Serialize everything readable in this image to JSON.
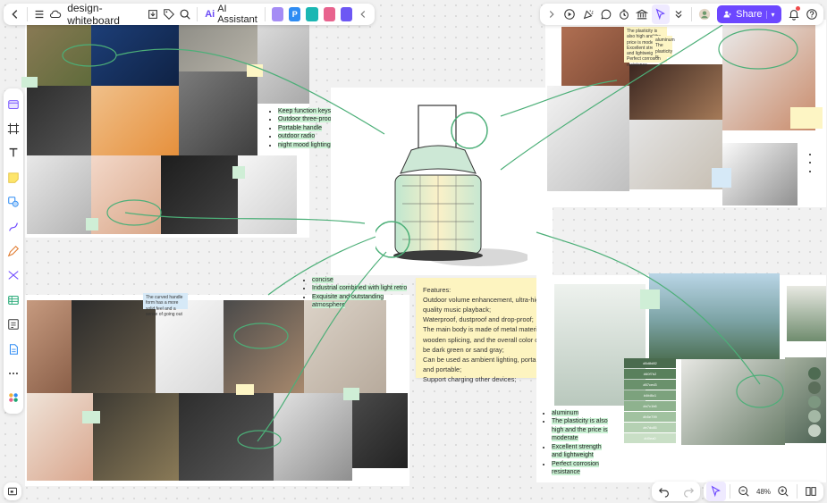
{
  "toolbar": {
    "doc_title": "design-whiteboard",
    "ai_label": "AI Assistant",
    "ai_logo": "Ai",
    "chips": [
      {
        "label": "",
        "color": "#a58cf5"
      },
      {
        "label": "P",
        "color": "#2f8cf3"
      },
      {
        "label": "",
        "color": "#1bb7b3"
      },
      {
        "label": "",
        "color": "#e8638e"
      },
      {
        "label": "",
        "color": "#6d57f4"
      }
    ]
  },
  "right_toolbar": {
    "share_label": "Share",
    "accent": "#6c47ff"
  },
  "bottom_bar": {
    "zoom": "48%"
  },
  "canvas": {
    "mid_bullets": [
      "Keep function keys",
      "Outdoor three-proof",
      "Portable handle",
      "outdoor radio",
      "night mood lighting"
    ],
    "bottom_mid_bullets": [
      "concise",
      "Industrial combined with light retro",
      "Exquisite and outstanding atmosphere"
    ],
    "features": [
      "Features:",
      "Outdoor volume enhancement, ultra-high quality music playback;",
      "Waterproof, dustproof and drop-proof;",
      "The main body is made of metal material + wooden splicing, and the overall color can be dark green or sand gray;",
      "Can be used as ambient lighting, portable and portable;",
      "Support charging other devices;"
    ],
    "bottom_right_bullets": [
      "aluminum",
      "The plasticity is also high and the price is moderate",
      "Excellent strength and lightweight",
      "Perfect corrosion resistance"
    ],
    "top_right_note": "The plasticity is also high and the price is moderate; Excellent strength and lightweight; Perfect corrosion resistance",
    "side_note": "aluminum The plasticity is",
    "lamp_note": "The curved handle form has a more solid feel and a sense of going out",
    "palette_codes": [
      "#8d8d82",
      "#60f7b2",
      "#87ced3",
      "#4fd8c1",
      "#a7c1b6",
      "#b5e799",
      "#e7dc85",
      "#d0ea0"
    ],
    "palette_colors": [
      "#4a6b4e",
      "#59805c",
      "#6a916c",
      "#7ca27d",
      "#8eb28e",
      "#a1c2a0",
      "#b5d1b3",
      "#c9dfc6"
    ],
    "dot_colors": [
      "#4e6b52",
      "#5b6e5a",
      "#7d9780",
      "#a4b8a5",
      "#c5d1c4"
    ],
    "stroke_color": "#4caf78"
  }
}
